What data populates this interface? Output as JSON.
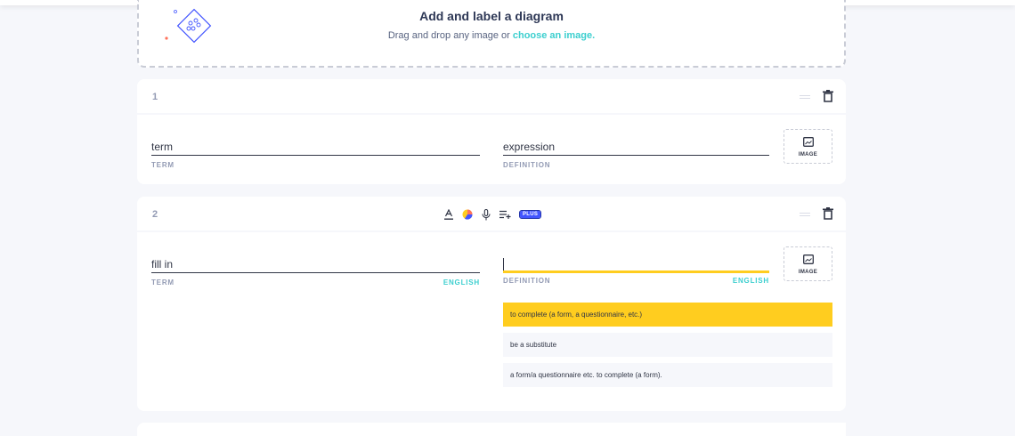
{
  "diagram": {
    "title": "Add and label a diagram",
    "subtitle_prefix": "Drag and drop any image or ",
    "link": "choose an image."
  },
  "cards": [
    {
      "number": "1",
      "term": "term",
      "term_label": "TERM",
      "definition": "expression",
      "definition_label": "DEFINITION",
      "image_label": "IMAGE"
    },
    {
      "number": "2",
      "term": "fill in",
      "term_label": "TERM",
      "term_lang": "ENGLISH",
      "definition": "",
      "definition_label": "DEFINITION",
      "definition_lang": "ENGLISH",
      "image_label": "IMAGE",
      "toolbar": {
        "text_format_icon": "text-color-icon",
        "color_icon": "color-palette-icon",
        "mic_icon": "microphone-icon",
        "add_list_icon": "add-list-icon",
        "plus_badge": "PLUS"
      },
      "suggestions": [
        "to complete (a form, a questionnaire, etc.)",
        "be a substitute",
        "a form/a questionnaire etc. to complete (a form)."
      ]
    }
  ],
  "colors": {
    "accent": "#3ccfcf",
    "highlight": "#ffcd1f",
    "plus": "#4255ff",
    "background": "#f6f7fb"
  }
}
